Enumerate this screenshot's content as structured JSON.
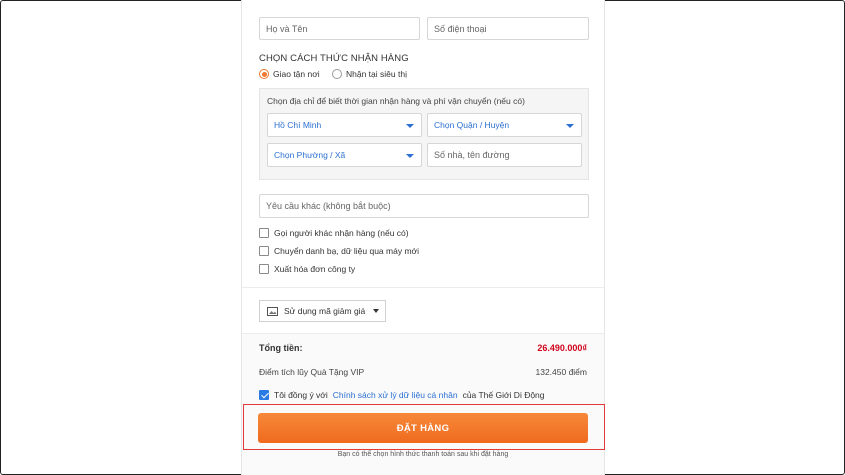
{
  "customer": {
    "name_placeholder": "Họ và Tên",
    "phone_placeholder": "Số điện thoại"
  },
  "delivery": {
    "section_title": "CHỌN CÁCH THỨC NHẬN HÀNG",
    "options": [
      {
        "label": "Giao tận nơi",
        "selected": true
      },
      {
        "label": "Nhận tại siêu thị",
        "selected": false
      }
    ],
    "address_hint": "Chọn địa chỉ để biết thời gian nhận hàng và phí vận chuyển (nếu có)",
    "city": "Hồ Chí Minh",
    "district": "Chọn Quận / Huyện",
    "ward": "Chọn Phường / Xã",
    "street_placeholder": "Số nhà, tên đường"
  },
  "other_request_placeholder": "Yêu cầu khác (không bắt buộc)",
  "extras": [
    {
      "label": "Gọi người khác nhận hàng (nếu có)",
      "checked": false
    },
    {
      "label": "Chuyển danh bạ, dữ liệu qua máy mới",
      "checked": false
    },
    {
      "label": "Xuất hóa đơn công ty",
      "checked": false
    }
  ],
  "coupon": {
    "label": "Sử dụng mã giảm giá",
    "icon": "coupon-icon"
  },
  "summary": {
    "total_label": "Tổng tiền:",
    "total_value": "26.490.000₫",
    "points_label": "Điểm tích lũy Quà Tặng VIP",
    "points_value": "132.450 điểm"
  },
  "agreement": {
    "prefix": "Tôi đồng ý với",
    "link": "Chính sách xử lý dữ liệu cá nhân",
    "suffix": "của Thế Giới Di Động",
    "checked": true
  },
  "order_button": "ĐẶT HÀNG",
  "footnote": "Bạn có thể chọn hình thức thanh toán sau khi đặt hàng",
  "colors": {
    "accent": "#f0772f",
    "link": "#2a6fd1",
    "price": "#d0021b",
    "highlight": "#e03b3b"
  }
}
